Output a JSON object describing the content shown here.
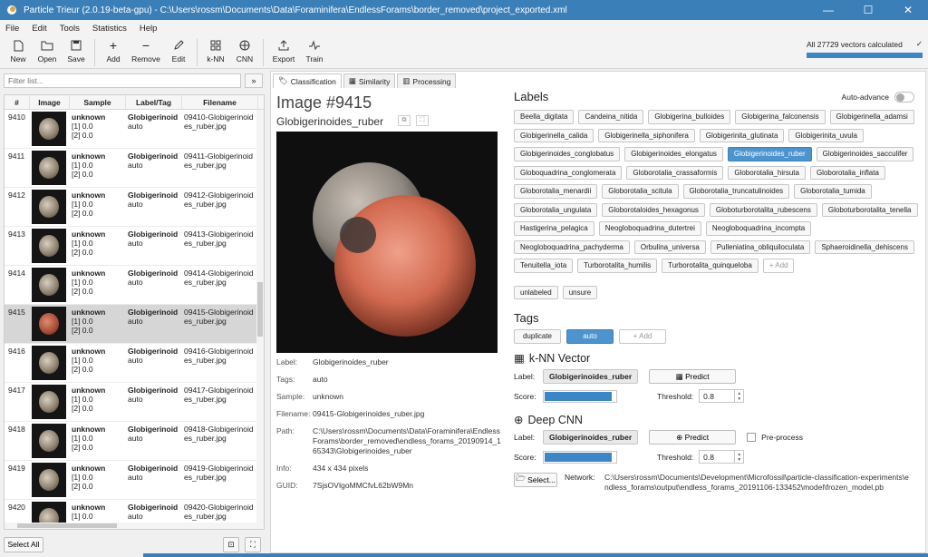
{
  "window": {
    "title": "Particle Trieur (2.0.19-beta-gpu)  -  C:\\Users\\rossm\\Documents\\Data\\Foraminifera\\EndlessForams\\border_removed\\project_exported.xml"
  },
  "menu": [
    "File",
    "Edit",
    "Tools",
    "Statistics",
    "Help"
  ],
  "toolbar": {
    "new": "New",
    "open": "Open",
    "save": "Save",
    "add": "Add",
    "remove": "Remove",
    "edit": "Edit",
    "knn": "k-NN",
    "cnn": "CNN",
    "export": "Export",
    "train": "Train",
    "vectors_status": "All 27729 vectors calculated"
  },
  "filter": {
    "placeholder": "Filter list...",
    "button": "»"
  },
  "table": {
    "headers": [
      "#",
      "Image",
      "Sample",
      "Label/Tag",
      "Filename"
    ],
    "rows": [
      {
        "num": "9410",
        "sample": "unknown",
        "s1": "[1] 0.0",
        "s2": "[2] 0.0",
        "label": "Globigerinoid",
        "tag": "auto",
        "f1": "09410-Globigerinoid",
        "f2": "es_ruber.jpg"
      },
      {
        "num": "9411",
        "sample": "unknown",
        "s1": "[1] 0.0",
        "s2": "[2] 0.0",
        "label": "Globigerinoid",
        "tag": "auto",
        "f1": "09411-Globigerinoid",
        "f2": "es_ruber.jpg"
      },
      {
        "num": "9412",
        "sample": "unknown",
        "s1": "[1] 0.0",
        "s2": "[2] 0.0",
        "label": "Globigerinoid",
        "tag": "auto",
        "f1": "09412-Globigerinoid",
        "f2": "es_ruber.jpg"
      },
      {
        "num": "9413",
        "sample": "unknown",
        "s1": "[1] 0.0",
        "s2": "[2] 0.0",
        "label": "Globigerinoid",
        "tag": "auto",
        "f1": "09413-Globigerinoid",
        "f2": "es_ruber.jpg"
      },
      {
        "num": "9414",
        "sample": "unknown",
        "s1": "[1] 0.0",
        "s2": "[2] 0.0",
        "label": "Globigerinoid",
        "tag": "auto",
        "f1": "09414-Globigerinoid",
        "f2": "es_ruber.jpg"
      },
      {
        "num": "9415",
        "sample": "unknown",
        "s1": "[1] 0.0",
        "s2": "[2] 0.0",
        "label": "Globigerinoid",
        "tag": "auto",
        "f1": "09415-Globigerinoid",
        "f2": "es_ruber.jpg"
      },
      {
        "num": "9416",
        "sample": "unknown",
        "s1": "[1] 0.0",
        "s2": "[2] 0.0",
        "label": "Globigerinoid",
        "tag": "auto",
        "f1": "09416-Globigerinoid",
        "f2": "es_ruber.jpg"
      },
      {
        "num": "9417",
        "sample": "unknown",
        "s1": "[1] 0.0",
        "s2": "[2] 0.0",
        "label": "Globigerinoid",
        "tag": "auto",
        "f1": "09417-Globigerinoid",
        "f2": "es_ruber.jpg"
      },
      {
        "num": "9418",
        "sample": "unknown",
        "s1": "[1] 0.0",
        "s2": "[2] 0.0",
        "label": "Globigerinoid",
        "tag": "auto",
        "f1": "09418-Globigerinoid",
        "f2": "es_ruber.jpg"
      },
      {
        "num": "9419",
        "sample": "unknown",
        "s1": "[1] 0.0",
        "s2": "[2] 0.0",
        "label": "Globigerinoid",
        "tag": "auto",
        "f1": "09419-Globigerinoid",
        "f2": "es_ruber.jpg"
      },
      {
        "num": "9420",
        "sample": "unknown",
        "s1": "[1] 0.0",
        "s2": "[2] 0.0",
        "label": "Globigerinoid",
        "tag": "auto",
        "f1": "09420-Globigerinoid",
        "f2": "es_ruber.jpg"
      }
    ]
  },
  "select_all": "Select All",
  "tabs": [
    "Classification",
    "Similarity",
    "Processing"
  ],
  "image": {
    "title": "Image #9415",
    "label": "Globigerinoides_ruber",
    "meta": [
      {
        "k": "Label:",
        "v": "Globigerinoides_ruber"
      },
      {
        "k": "Tags:",
        "v": "auto"
      },
      {
        "k": "Sample:",
        "v": "unknown"
      },
      {
        "k": "Filename:",
        "v": "09415-Globigerinoides_ruber.jpg"
      },
      {
        "k": "Path:",
        "v": "C:\\Users\\rossm\\Documents\\Data\\Foraminifera\\EndlessForams\\border_removed\\endless_forams_20190914_165343\\Globigerinoides_ruber"
      },
      {
        "k": "Info:",
        "v": "434 x 434 pixels"
      },
      {
        "k": "GUID:",
        "v": "7SjsOVIgoMMCfvL62bW9Mn"
      }
    ]
  },
  "labels": {
    "heading": "Labels",
    "auto_advance": "Auto-advance",
    "items": [
      "Beella_digitata",
      "Candeina_nitida",
      "Globigerina_bulloides",
      "Globigerina_falconensis",
      "Globigerinella_adamsi",
      "Globigerinella_calida",
      "Globigerinella_siphonifera",
      "Globigerinita_glutinata",
      "Globigerinita_uvula",
      "Globigerinoides_conglobatus",
      "Globigerinoides_elongatus",
      "Globigerinoides_ruber",
      "Globigerinoides_sacculifer",
      "Globoquadrina_conglomerata",
      "Globorotalia_crassaformis",
      "Globorotalia_hirsuta",
      "Globorotalia_inflata",
      "Globorotalia_menardii",
      "Globorotalia_scitula",
      "Globorotalia_truncatulinoides",
      "Globorotalia_tumida",
      "Globorotalia_ungulata",
      "Globorotaloides_hexagonus",
      "Globoturborotalita_rubescens",
      "Globoturborotalita_tenella",
      "Hastigerina_pelagica",
      "Neogloboquadrina_dutertrei",
      "Neogloboquadrina_incompta",
      "Neogloboquadrina_pachyderma",
      "Orbulina_universa",
      "Pulleniatina_obliquiloculata",
      "Sphaeroidinella_dehiscens",
      "Tenuitella_iota",
      "Turborotalita_humilis",
      "Turborotalita_quinqueloba"
    ],
    "selected": "Globigerinoides_ruber",
    "add": "+ Add",
    "extra": [
      "unlabeled",
      "unsure"
    ]
  },
  "tags": {
    "heading": "Tags",
    "items": [
      "duplicate",
      "auto"
    ],
    "selected": "auto",
    "add": "+ Add"
  },
  "knn": {
    "heading": "k-NN Vector",
    "label_key": "Label:",
    "label": "Globigerinoides_ruber",
    "predict": "Predict",
    "score_key": "Score:",
    "score": 0.95,
    "threshold_key": "Threshold:",
    "threshold": "0.8"
  },
  "cnn": {
    "heading": "Deep CNN",
    "label_key": "Label:",
    "label": "Globigerinoides_ruber",
    "predict": "Predict",
    "preprocess": "Pre-process",
    "score_key": "Score:",
    "score": 0.95,
    "threshold_key": "Threshold:",
    "threshold": "0.8",
    "select": "Select...",
    "network_key": "Network:",
    "network": "C:\\Users\\rossm\\Documents\\Development\\Microfossil\\particle-classification-experiments\\endless_forams\\output\\endless_forams_20191106-133452\\model\\frozen_model.pb"
  },
  "colors": {
    "accent": "#3b7fb8",
    "selected_chip": "#4d94ce"
  }
}
